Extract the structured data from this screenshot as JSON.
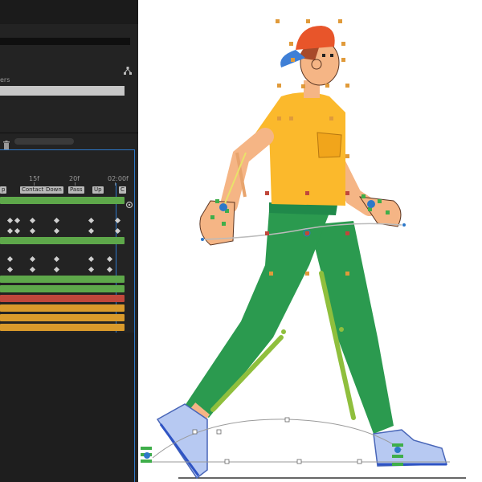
{
  "timeline": {
    "layers_label_fragment": "ers",
    "ruler_labels": [
      "15f",
      "20f",
      "02:00f"
    ],
    "markers": [
      "p",
      "Contact",
      "Down",
      "Pass",
      "Up",
      "C"
    ],
    "icons": {
      "network": "network-icon",
      "trash": "trash-icon",
      "shy": "shy-icon"
    }
  },
  "colors": {
    "panel_bg": "#232323",
    "track_green": "#5ea84a",
    "track_red": "#c0473b",
    "track_orange": "#d99a2b",
    "shirt": "#fbb92c",
    "pants": "#2b9a4f",
    "cap": "#e8552a",
    "cap_brim": "#3f7fd6",
    "skin": "#f5b585",
    "hair": "#a84a2a",
    "shoe": "#b7c9f2"
  }
}
